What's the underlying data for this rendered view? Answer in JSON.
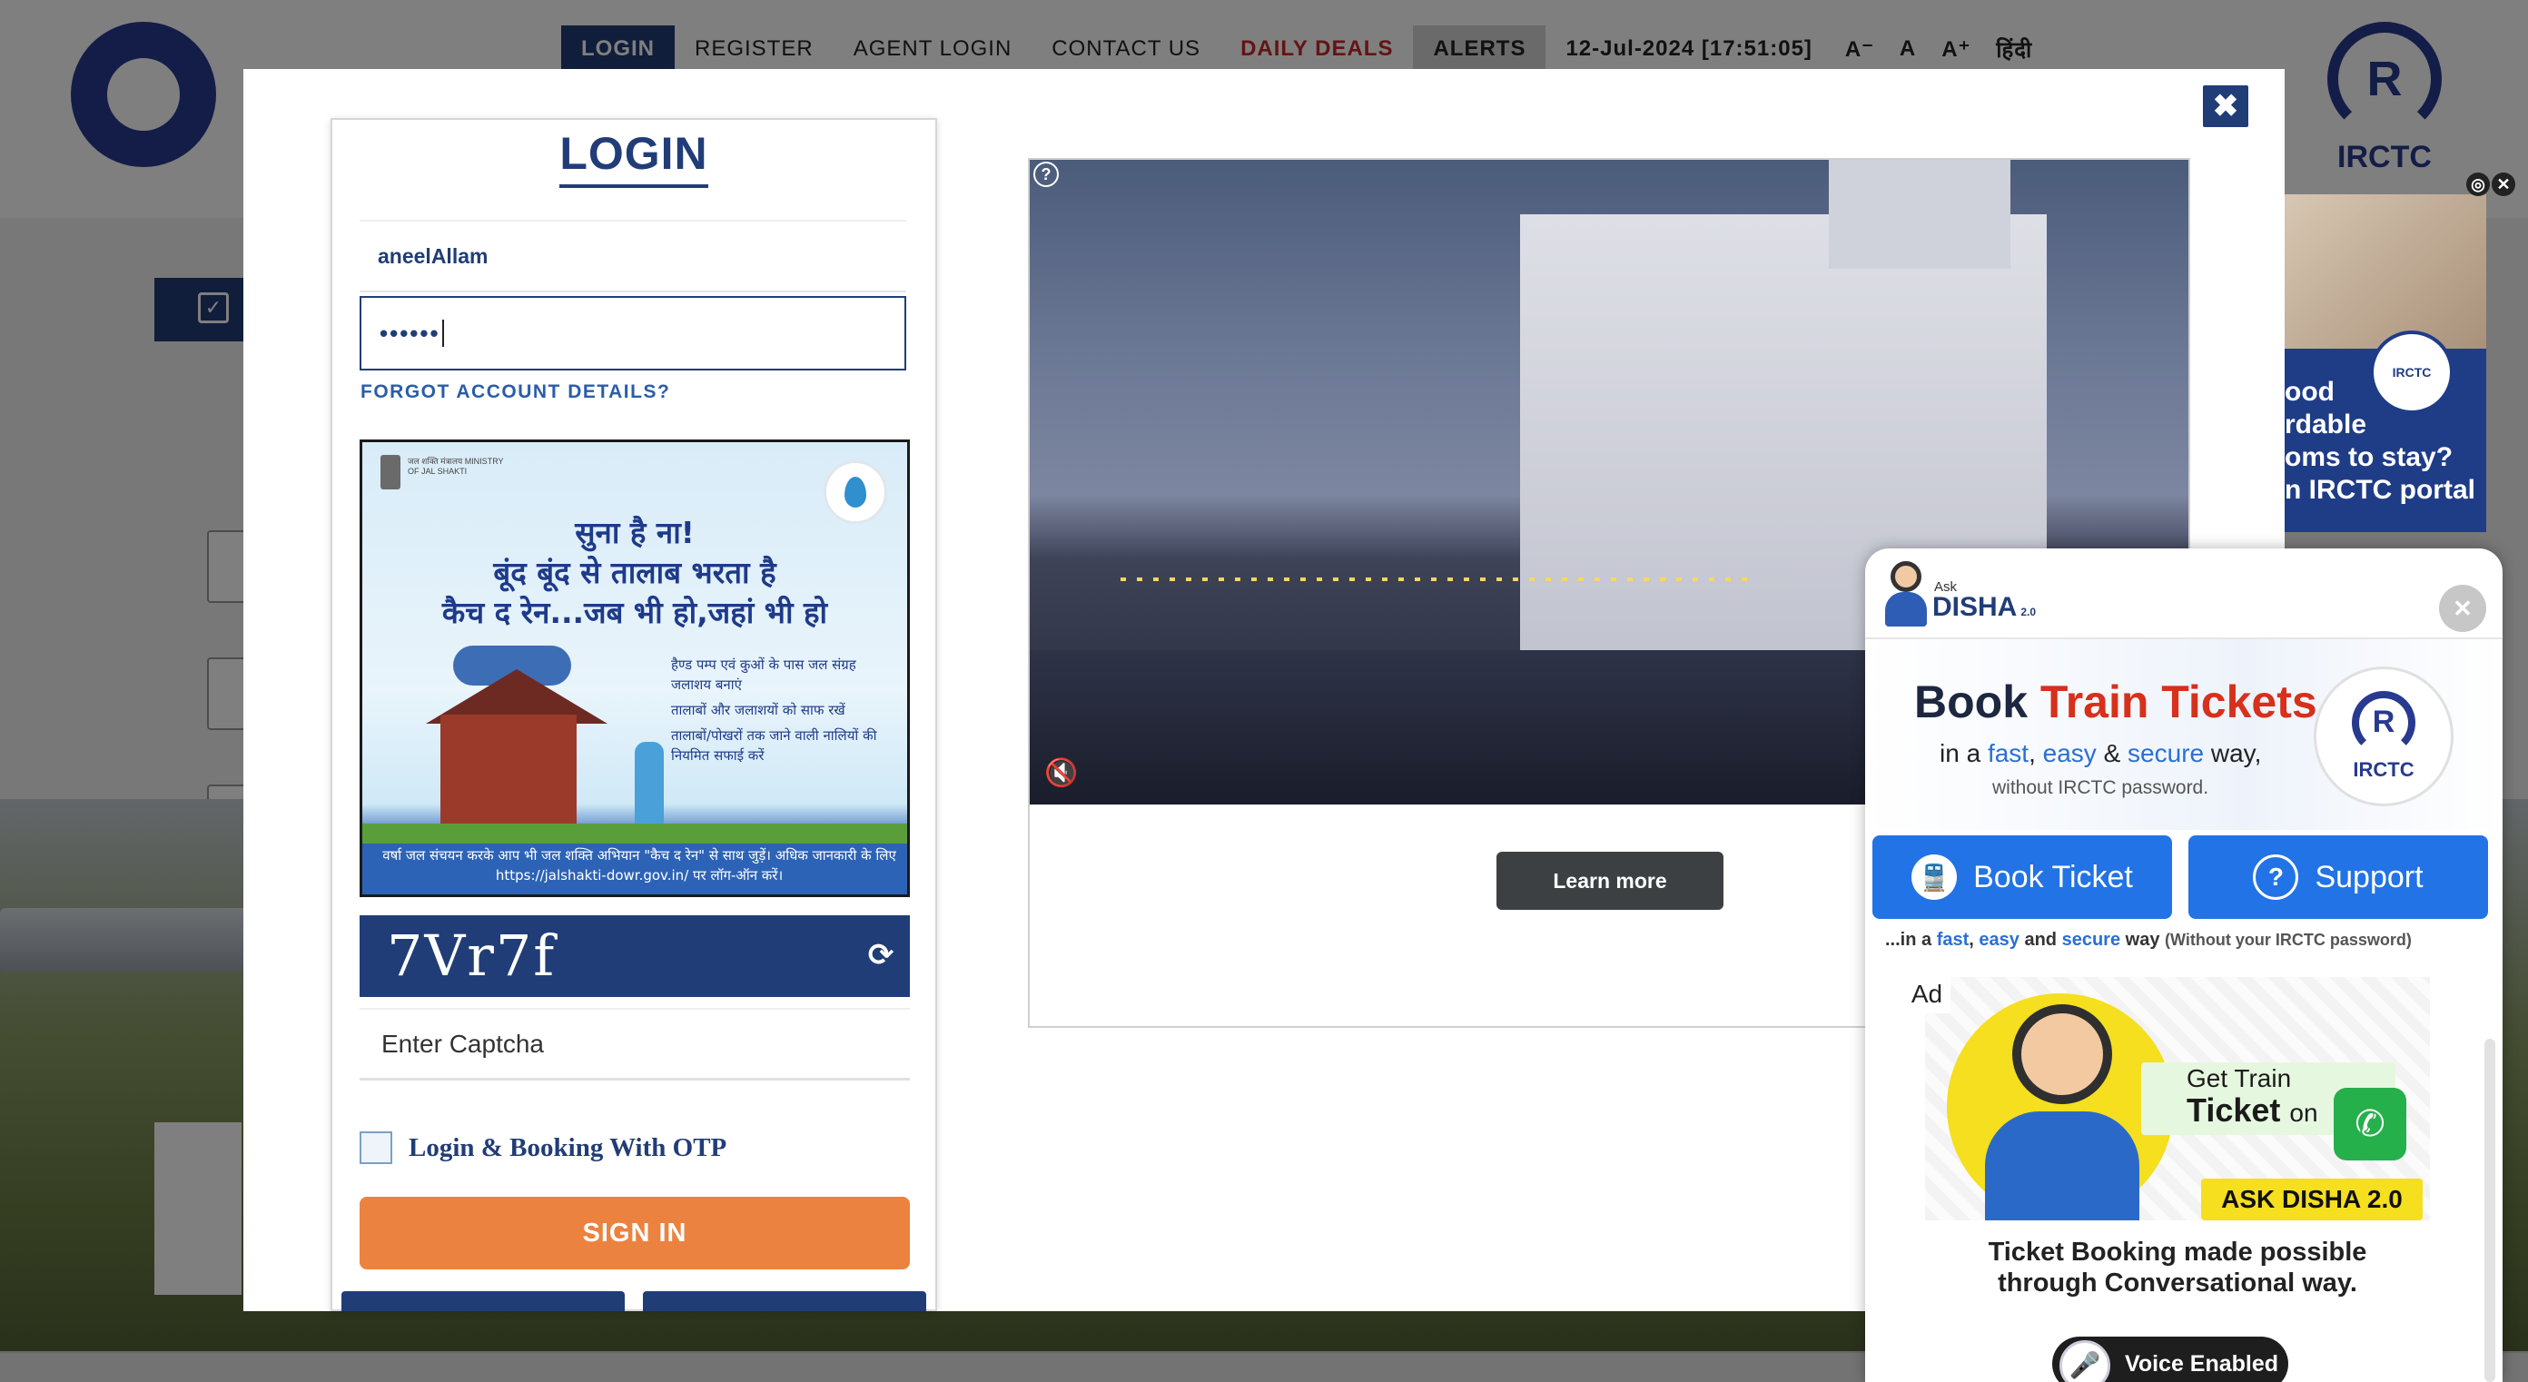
{
  "header": {
    "nav": [
      "LOGIN",
      "REGISTER",
      "AGENT LOGIN",
      "CONTACT US",
      "DAILY DEALS",
      "ALERTS"
    ],
    "datetime": "12-Jul-2024 [17:51:05]",
    "font_small": "A⁻",
    "font_normal": "A",
    "font_large": "A⁺",
    "language": "हिंदी",
    "irctc_logo_text": "IRCTC"
  },
  "modal": {
    "close_icon": "✖",
    "login": {
      "title": "LOGIN",
      "username_value": "aneelAllam",
      "password_value": "••••••",
      "forgot_link": "FORGOT ACCOUNT DETAILS?",
      "captcha_text": "7Vr7f",
      "captcha_refresh_icon": "⟳",
      "captcha_placeholder": "Enter Captcha",
      "otp_label": "Login & Booking With OTP",
      "sign_in": "SIGN IN"
    },
    "poster": {
      "gov_text": "जल शक्ति मंत्रालय MINISTRY OF JAL SHAKTI",
      "line1": "सुना है ना!",
      "line2": "बूंद बूंद से तालाब भरता है",
      "line3": "कैच द रेन...जब भी हो,जहां भी हो",
      "bullets": [
        "हैण्ड पम्प एवं कुओं के पास जल संग्रह जलाशय बनाएं",
        "तालाबों और जलाशयों को साफ रखें",
        "तालाबों/पोखरों तक जाने वाली नालियों की नियमित सफाई करें"
      ],
      "footer": "वर्षा जल संचयन करके आप भी जल शक्ति अभियान \"कैच द रेन\" से साथ जुड़ें। अधिक जानकारी के लिए https://jalshakti-dowr.gov.in/ पर लॉग-ऑन करें।"
    },
    "video_ad": {
      "help_icon": "?",
      "mute_icon": "🔇",
      "learn_more": "Learn more"
    }
  },
  "side_ad": {
    "lines": [
      "ood",
      "rdable",
      "oms to stay?",
      "n IRCTC portal"
    ],
    "logo": "IRCTC",
    "ctrl_icon": "◎",
    "close_icon": "✕"
  },
  "disha": {
    "ask": "Ask",
    "name": "DISHA",
    "version": "2.0",
    "close_icon": "✕",
    "headline_book": "Book",
    "headline_tickets": "Train Tickets",
    "sub_in_a": "in a",
    "sub_fast": "fast",
    "sub_easy": "easy",
    "sub_amp": "&",
    "sub_secure": "secure",
    "sub_way": "way,",
    "sub_password": "without IRCTC password.",
    "logo_text": "IRCTC",
    "book_ticket": "Book Ticket",
    "support": "Support",
    "tagline_start": "...in a",
    "tagline_fast": "fast",
    "tagline_easy": "easy",
    "tagline_and": "and",
    "tagline_secure": "secure",
    "tagline_way": "way",
    "tagline_note": "(Without your IRCTC password)",
    "ad_label": "Ad",
    "ad_get": "Get Train",
    "ad_ticket": "Ticket",
    "ad_on": "on",
    "ad_banner": "ASK DISHA 2.0",
    "ad_line1": "Ticket Booking made possible",
    "ad_line2": "through Conversational way.",
    "ad_voice": "Voice Enabled"
  },
  "colors": {
    "primary": "#213d77",
    "accent_orange": "#ec8240",
    "deals_red": "#c62828",
    "disha_blue": "#2273e6"
  }
}
